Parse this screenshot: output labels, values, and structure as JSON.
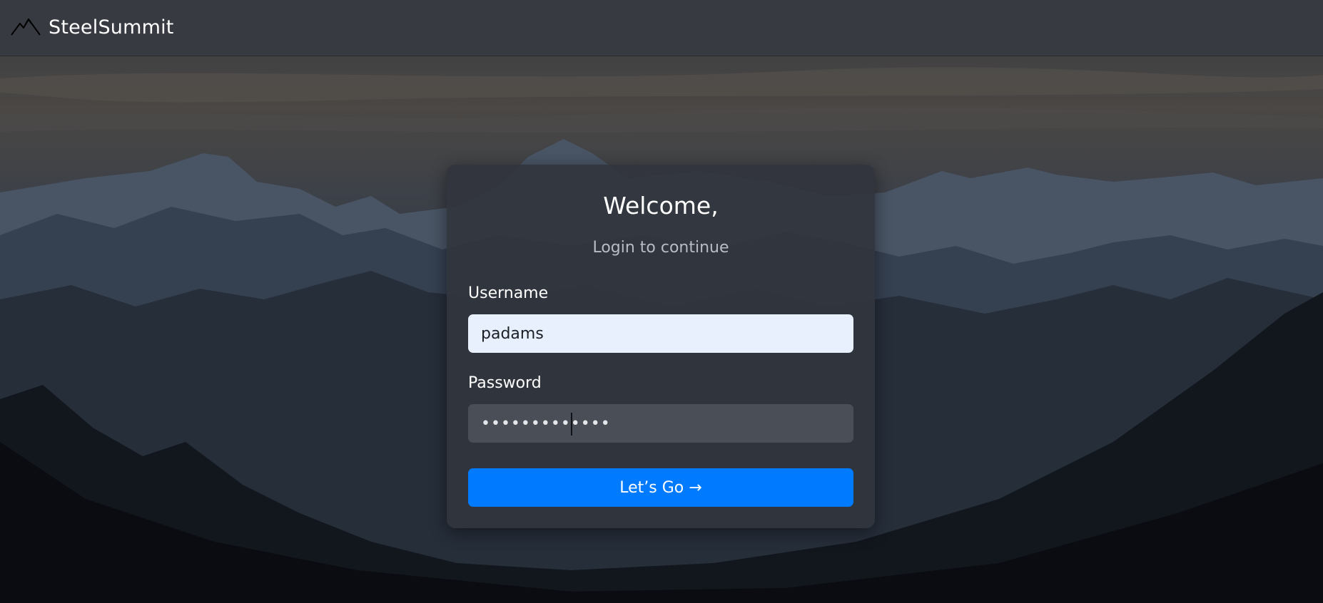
{
  "brand": {
    "name": "SteelSummit",
    "icon": "mountain-icon"
  },
  "login": {
    "title": "Welcome,",
    "subtitle": "Login to continue",
    "username_label": "Username",
    "username_value": "padams",
    "password_label": "Password",
    "password_value": "•••••••••••••",
    "submit_label": "Let’s Go →"
  },
  "colors": {
    "navbar": "#373a41",
    "card": "#32353c",
    "accent": "#007bff",
    "username_field": "#e8f0fe",
    "password_field": "#4a4e56"
  }
}
